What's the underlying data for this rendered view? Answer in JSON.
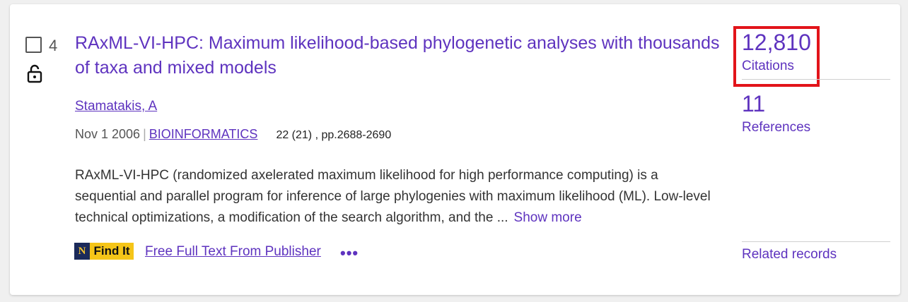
{
  "record": {
    "number": "4",
    "title": "RAxML-VI-HPC: Maximum likelihood-based phylogenetic analyses with thousands of taxa and mixed models",
    "author": "Stamatakis, A",
    "date": "Nov 1 2006",
    "separator": "|",
    "journal": "BIOINFORMATICS",
    "volume_pages": "22 (21) , pp.2688-2690",
    "abstract": "RAxML-VI-HPC (randomized axelerated maximum likelihood for high performance computing) is a sequential and parallel program for inference of large phylogenies with maximum likelihood (ML). Low-level technical optimizations, a modification of the search algorithm, and the ...",
    "show_more": "Show more",
    "find_it_logo_letter": "N",
    "find_it_label": "Find It",
    "full_text_link": "Free Full Text From Publisher",
    "more_options": "•••"
  },
  "metrics": {
    "citations_count": "12,810",
    "citations_label": "Citations",
    "references_count": "11",
    "references_label": "References",
    "related_label": "Related records"
  },
  "colors": {
    "link": "#5e33bf",
    "highlight_box": "#e2141a",
    "findit_yellow": "#f5c518",
    "findit_navy": "#1b2a5a"
  },
  "icons": {
    "checkbox": "checkbox-unchecked-icon",
    "lock": "unlocked-padlock-icon",
    "more": "more-horizontal-icon"
  }
}
